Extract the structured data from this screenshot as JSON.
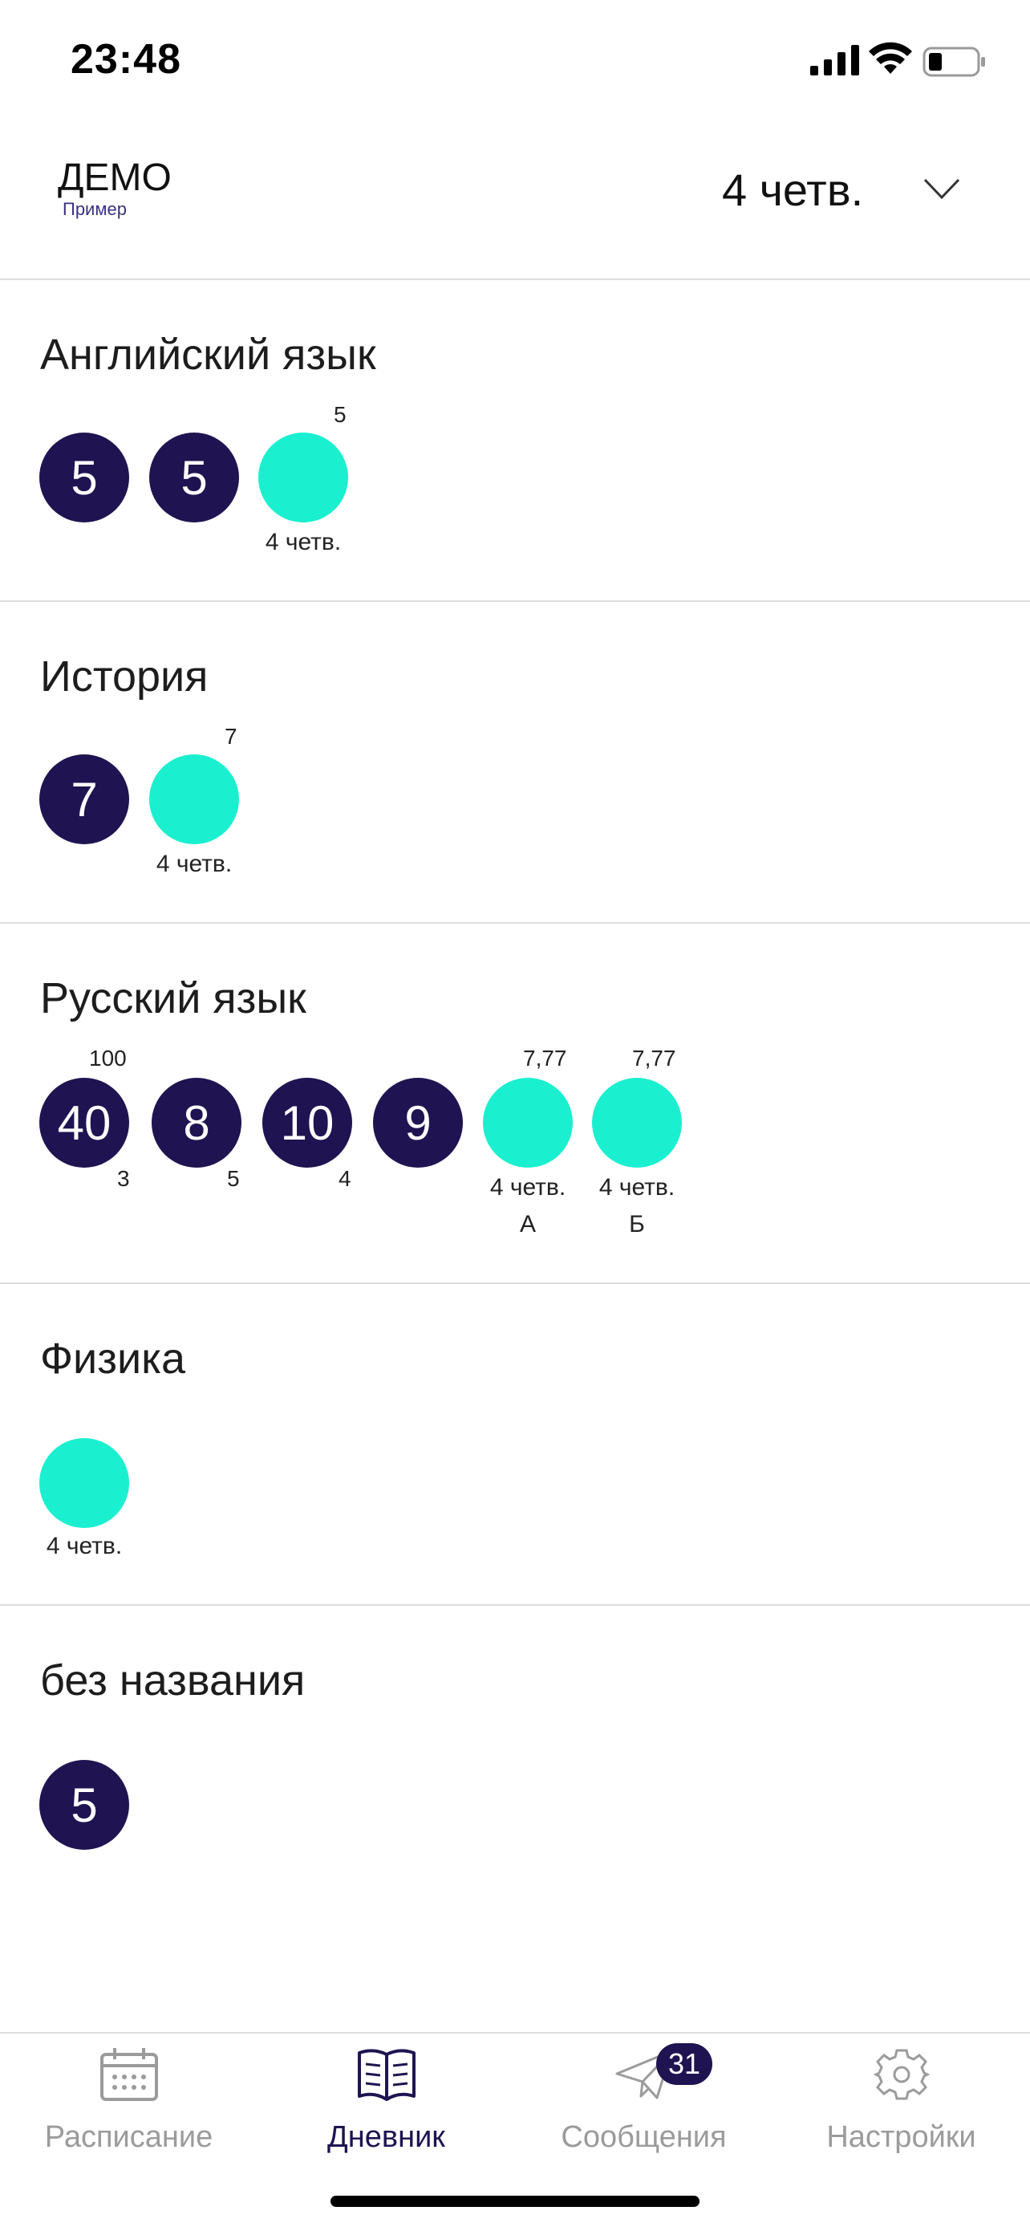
{
  "status_bar": {
    "time": "23:48"
  },
  "header": {
    "account_name": "ДЕМО",
    "account_sub": "Пример",
    "period": "4 четв.",
    "period_icon": "chevron-down-icon"
  },
  "subjects": [
    {
      "title": "Английский язык",
      "marks": [
        {
          "value": "5",
          "type": "grade"
        },
        {
          "value": "5",
          "type": "grade"
        },
        {
          "value": "",
          "type": "period",
          "sup": "5",
          "caption": "4 четв."
        }
      ]
    },
    {
      "title": "История",
      "marks": [
        {
          "value": "7",
          "type": "grade"
        },
        {
          "value": "",
          "type": "period",
          "sup": "7",
          "caption": "4 четв."
        }
      ]
    },
    {
      "title": "Русский язык",
      "marks": [
        {
          "value": "40",
          "type": "grade",
          "sup": "100",
          "sub": "3"
        },
        {
          "value": "8",
          "type": "grade",
          "sub": "5"
        },
        {
          "value": "10",
          "type": "grade",
          "sub": "4"
        },
        {
          "value": "9",
          "type": "grade"
        },
        {
          "value": "",
          "type": "period",
          "sup": "7,77",
          "caption": "4 четв.",
          "caption2": "А"
        },
        {
          "value": "",
          "type": "period",
          "sup": "7,77",
          "caption": "4 четв.",
          "caption2": "Б"
        }
      ]
    },
    {
      "title": "Физика",
      "marks": [
        {
          "value": "",
          "type": "period",
          "caption": "4 четв."
        }
      ]
    },
    {
      "title": "без названия",
      "marks": [
        {
          "value": "5",
          "type": "grade"
        }
      ]
    }
  ],
  "tabbar": {
    "tabs": [
      {
        "label": "Расписание",
        "icon": "calendar-icon"
      },
      {
        "label": "Дневник",
        "icon": "book-icon",
        "active": true
      },
      {
        "label": "Сообщения",
        "icon": "paper-plane-icon",
        "badge": "31"
      },
      {
        "label": "Настройки",
        "icon": "gear-icon"
      }
    ]
  },
  "colors": {
    "grade": "#1f1451",
    "period": "#1af0cf",
    "inactive": "#9b9b9b"
  }
}
